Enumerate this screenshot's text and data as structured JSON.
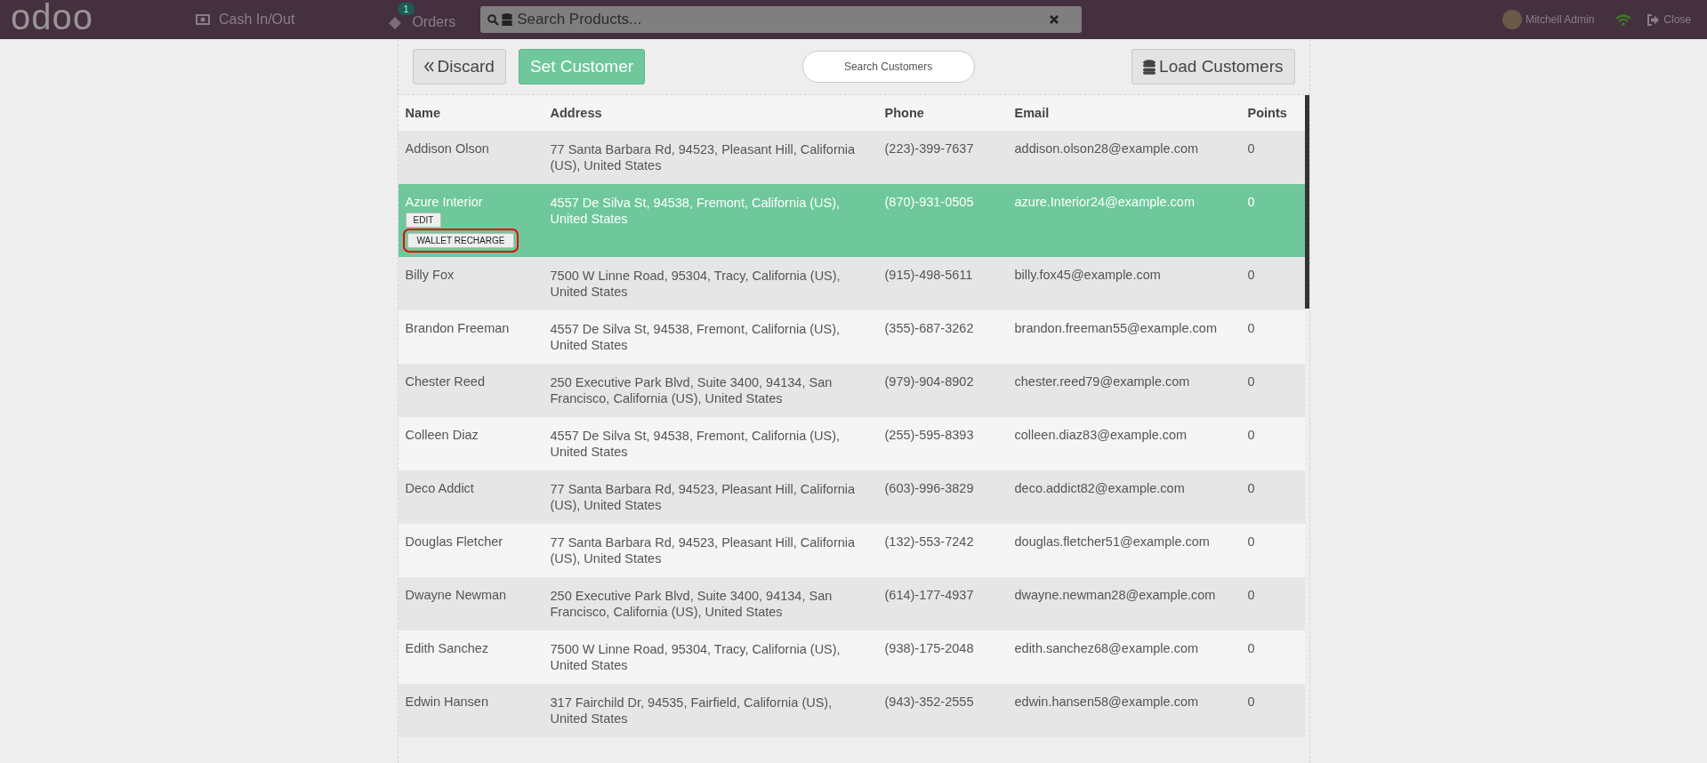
{
  "top_bar": {
    "logo": "odoo",
    "cash_button": "Cash In/Out",
    "orders_button": {
      "label": "Orders",
      "badge": "1"
    },
    "search": {
      "placeholder": "Search Products..."
    },
    "user": "Mitchell Admin",
    "close_button": "Close"
  },
  "toolbar": {
    "discard": "Discard",
    "set_customer": "Set Customer",
    "search": {
      "placeholder": "Search Customers"
    },
    "load_customers": "Load Customers"
  },
  "table": {
    "columns": [
      "Name",
      "Address",
      "Phone",
      "Email",
      "Points"
    ],
    "rows": [
      {
        "name": "Addison Olson",
        "address": "77 Santa Barbara Rd, 94523, Pleasant Hill, California (US), United States",
        "phone": "(223)-399-7637",
        "email": "addison.olson28@example.com",
        "points": "0",
        "selected": false
      },
      {
        "name": "Azure Interior",
        "address": "4557 De Silva St, 94538, Fremont, California (US), United States",
        "phone": "(870)-931-0505",
        "email": "azure.Interior24@example.com",
        "points": "0",
        "selected": true,
        "actions": [
          {
            "label": "EDIT",
            "highlighted": false
          },
          {
            "label": "WALLET RECHARGE",
            "highlighted": true
          }
        ]
      },
      {
        "name": "Billy Fox",
        "address": "7500 W Linne Road, 95304, Tracy, California (US), United States",
        "phone": "(915)-498-5611",
        "email": "billy.fox45@example.com",
        "points": "0",
        "selected": false
      },
      {
        "name": "Brandon Freeman",
        "address": "4557 De Silva St, 94538, Fremont, California (US), United States",
        "phone": "(355)-687-3262",
        "email": "brandon.freeman55@example.com",
        "points": "0",
        "selected": false
      },
      {
        "name": "Chester Reed",
        "address": "250 Executive Park Blvd, Suite 3400, 94134, San Francisco, California (US), United States",
        "phone": "(979)-904-8902",
        "email": "chester.reed79@example.com",
        "points": "0",
        "selected": false
      },
      {
        "name": "Colleen Diaz",
        "address": "4557 De Silva St, 94538, Fremont, California (US), United States",
        "phone": "(255)-595-8393",
        "email": "colleen.diaz83@example.com",
        "points": "0",
        "selected": false
      },
      {
        "name": "Deco Addict",
        "address": "77 Santa Barbara Rd, 94523, Pleasant Hill, California (US), United States",
        "phone": "(603)-996-3829",
        "email": "deco.addict82@example.com",
        "points": "0",
        "selected": false
      },
      {
        "name": "Douglas Fletcher",
        "address": "77 Santa Barbara Rd, 94523, Pleasant Hill, California (US), United States",
        "phone": "(132)-553-7242",
        "email": "douglas.fletcher51@example.com",
        "points": "0",
        "selected": false
      },
      {
        "name": "Dwayne Newman",
        "address": "250 Executive Park Blvd, Suite 3400, 94134, San Francisco, California (US), United States",
        "phone": "(614)-177-4937",
        "email": "dwayne.newman28@example.com",
        "points": "0",
        "selected": false
      },
      {
        "name": "Edith Sanchez",
        "address": "7500 W Linne Road, 95304, Tracy, California (US), United States",
        "phone": "(938)-175-2048",
        "email": "edith.sanchez68@example.com",
        "points": "0",
        "selected": false
      },
      {
        "name": "Edwin Hansen",
        "address": "317 Fairchild Dr, 94535, Fairfield, California (US), United States",
        "phone": "(943)-352-2555",
        "email": "edwin.hansen58@example.com",
        "points": "0",
        "selected": false
      }
    ]
  }
}
